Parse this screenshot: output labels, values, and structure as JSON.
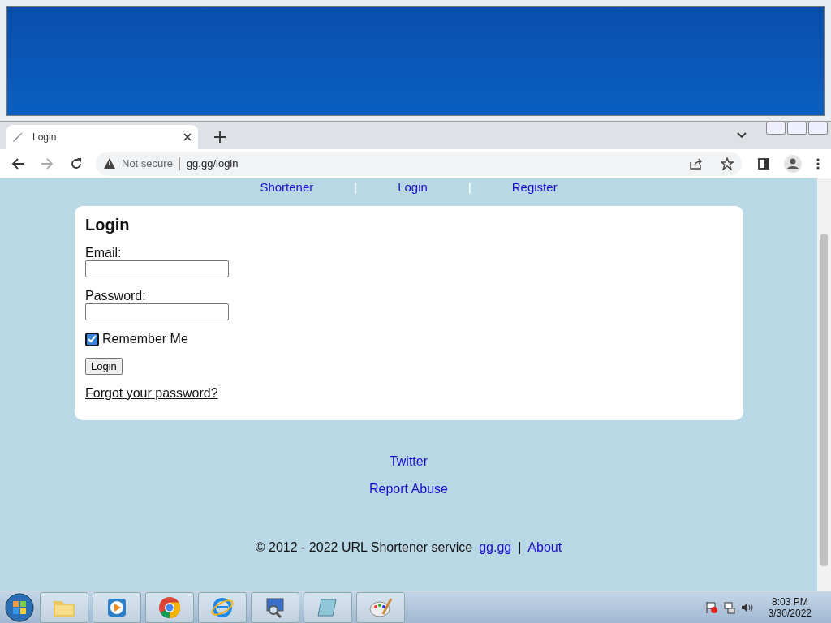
{
  "browser": {
    "tab": {
      "title": "Login"
    },
    "address": {
      "security": "Not secure",
      "url": "gg.gg/login"
    }
  },
  "nav": [
    {
      "label": "Shortener"
    },
    {
      "label": "Login"
    },
    {
      "label": "Register"
    }
  ],
  "nav_separators": [
    "|",
    "|"
  ],
  "login_card": {
    "title": "Login",
    "fields": [
      {
        "label": "Email:"
      },
      {
        "label": "Password:"
      }
    ],
    "remember": {
      "label": "Remember Me",
      "checked": true
    },
    "submit": "Login",
    "forgot_link": "Forgot your password?"
  },
  "footer": {
    "links": [
      "Twitter",
      "Report Abuse"
    ],
    "copyright": "© 2012 - 2022 URL Shortener service",
    "site_link": "gg.gg",
    "separator": "|",
    "about_link": "About"
  },
  "taskbar": {
    "apps": [
      {
        "kind": "folder"
      },
      {
        "kind": "media"
      },
      {
        "kind": "chrome"
      },
      {
        "kind": "ie"
      },
      {
        "kind": "remote"
      },
      {
        "kind": "notepad"
      },
      {
        "kind": "paint"
      }
    ],
    "clock": {
      "time": "8:03 PM",
      "date": "3/30/2022"
    }
  }
}
